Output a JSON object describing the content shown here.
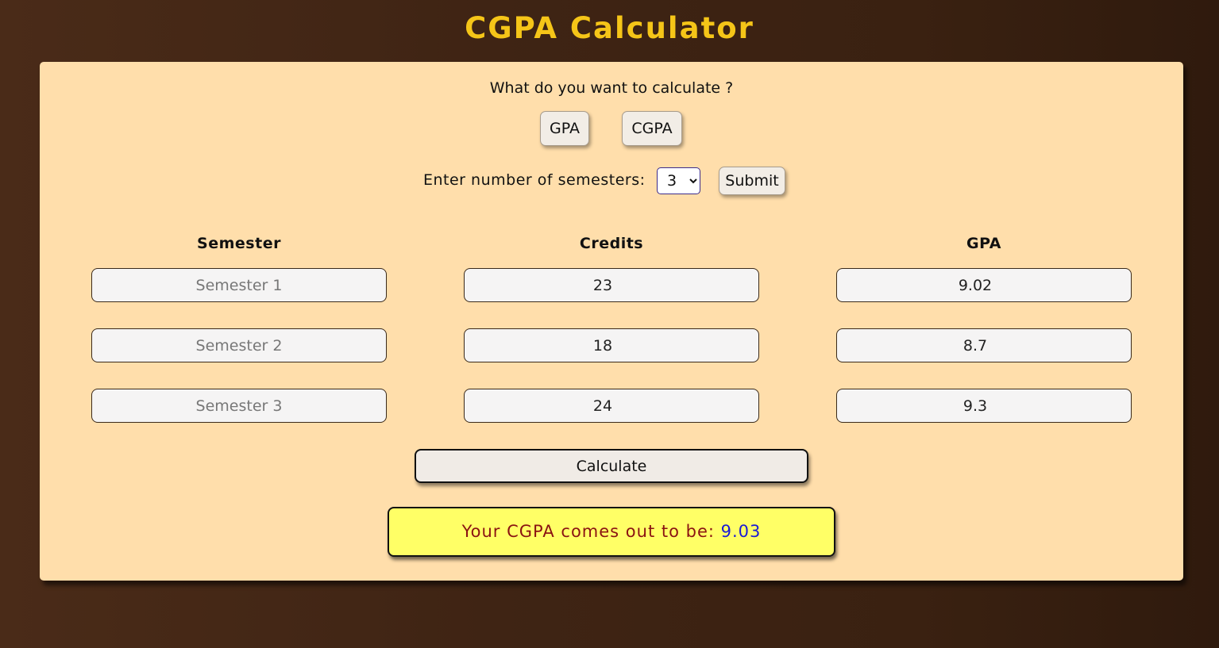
{
  "app": {
    "title": "CGPA Calculator"
  },
  "mode": {
    "question": "What do you want to calculate ?",
    "gpa_label": "GPA",
    "cgpa_label": "CGPA"
  },
  "semesters": {
    "label": "Enter number of semesters:",
    "selected": "3",
    "submit_label": "Submit"
  },
  "table": {
    "headers": [
      "Semester",
      "Credits",
      "GPA"
    ],
    "rows": [
      {
        "semester_placeholder": "Semester 1",
        "credits": "23",
        "gpa": "9.02"
      },
      {
        "semester_placeholder": "Semester 2",
        "credits": "18",
        "gpa": "8.7"
      },
      {
        "semester_placeholder": "Semester 3",
        "credits": "24",
        "gpa": "9.3"
      }
    ]
  },
  "calculate_label": "Calculate",
  "result": {
    "label": "Your CGPA comes out to be:",
    "value": "9.03"
  },
  "colors": {
    "background": "#3f2414",
    "card": "#ffdeab",
    "title": "#f5c518",
    "result_bg": "#ffff66",
    "result_text": "#8a1212",
    "result_value": "#1a1ad6"
  }
}
